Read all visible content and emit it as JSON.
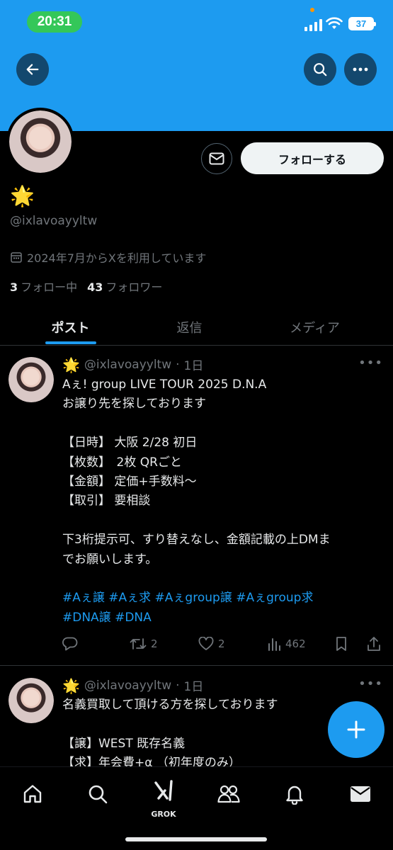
{
  "status_bar": {
    "time": "20:31",
    "battery": "37"
  },
  "profile": {
    "display_name": "🌟",
    "handle": "@ixlavoayyltw",
    "joined": "2024年7月からXを利用しています",
    "following_count": "3",
    "following_label": "フォロー中",
    "followers_count": "43",
    "followers_label": "フォロワー",
    "follow_button": "フォローする"
  },
  "tabs": [
    {
      "label": "ポスト",
      "active": true
    },
    {
      "label": "返信",
      "active": false
    },
    {
      "label": "メディア",
      "active": false
    }
  ],
  "posts": [
    {
      "name": "🌟",
      "handle": "@ixlavoayyltw",
      "time": "1日",
      "lines": [
        "Aぇ! group LIVE TOUR 2025 D.N.A",
        "お譲り先を探しております",
        "",
        "【日時】 大阪 2/28 初日",
        "【枚数】　2枚 QRごと",
        "【金額】 定価+手数料〜",
        "【取引】 要相談",
        "",
        "下3桁提示可、すり替えなし、金額記載の上DMま",
        "でお願いします。",
        "",
        "#Aぇ譲 #Aぇ求 #Aぇgroup譲 #Aぇgroup求",
        "#DNA譲 #DNA"
      ],
      "reposts": "2",
      "likes": "2",
      "views": "462"
    },
    {
      "name": "🌟",
      "handle": "@ixlavoayyltw",
      "time": "1日",
      "lines": [
        "名義買取して頂ける方を探しております",
        "",
        "【譲】WEST 既存名義",
        "【求】年会費+α （初年度のみ）"
      ]
    }
  ],
  "bottom_nav": {
    "items": [
      "home-icon",
      "search-icon",
      "grok-icon",
      "communities-icon",
      "notifications-icon",
      "messages-icon"
    ],
    "grok_label": "GROK"
  },
  "colors": {
    "accent": "#1d9bf0",
    "banner": "#1d9bf0",
    "background": "#000000",
    "muted": "#71767b",
    "status_green": "#34c759"
  }
}
